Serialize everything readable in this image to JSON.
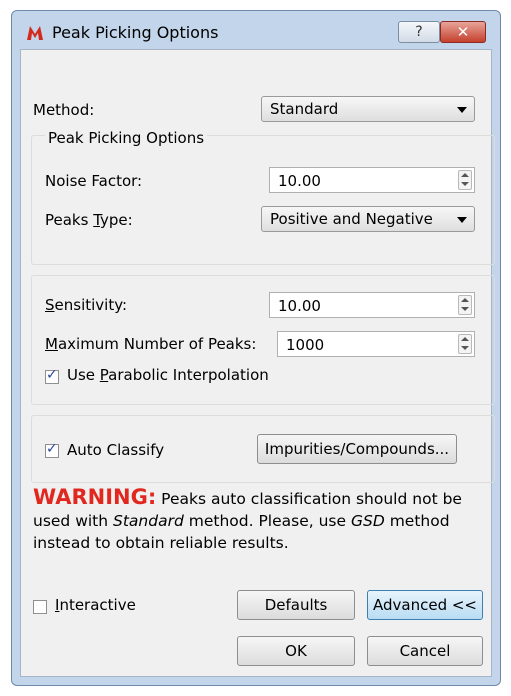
{
  "window": {
    "title": "Peak Picking Options",
    "help_label": "?",
    "close_label": "✕"
  },
  "method": {
    "label": "Method:",
    "value": "Standard"
  },
  "peak_picking_group": {
    "title": "Peak Picking Options",
    "noise_factor": {
      "label": "Noise Factor:",
      "value": "10.00"
    },
    "peaks_type": {
      "label_before": "Peaks ",
      "label_underlined": "T",
      "label_after": "ype:",
      "value": "Positive and Negative"
    }
  },
  "sensitivity_group": {
    "sensitivity": {
      "label_underlined": "S",
      "label_after": "ensitivity:",
      "value": "10.00"
    },
    "max_peaks": {
      "label_underlined": "M",
      "label_after": "aximum Number of Peaks:",
      "value": "1000"
    },
    "parabolic": {
      "label_before": "Use ",
      "label_underlined": "P",
      "label_after": "arabolic Interpolation",
      "checked": true
    }
  },
  "classify_group": {
    "auto_classify": {
      "label": "Auto Classify",
      "checked": true
    },
    "impurities_button": "Impurities/Compounds..."
  },
  "warning": {
    "title": "WARNING:",
    "text_1": " Peaks auto classification should not be used with ",
    "emph_1": "Standard",
    "text_2": " method. Please, use ",
    "emph_2": "GSD",
    "text_3": " method instead to obtain reliable results.",
    "color": "#e0281f"
  },
  "bottom": {
    "interactive": {
      "label_underlined": "I",
      "label_after": "nteractive",
      "checked": false
    },
    "defaults_button": "Defaults",
    "advanced_button": "Advanced <<",
    "ok_button": "OK",
    "cancel_button": "Cancel"
  }
}
